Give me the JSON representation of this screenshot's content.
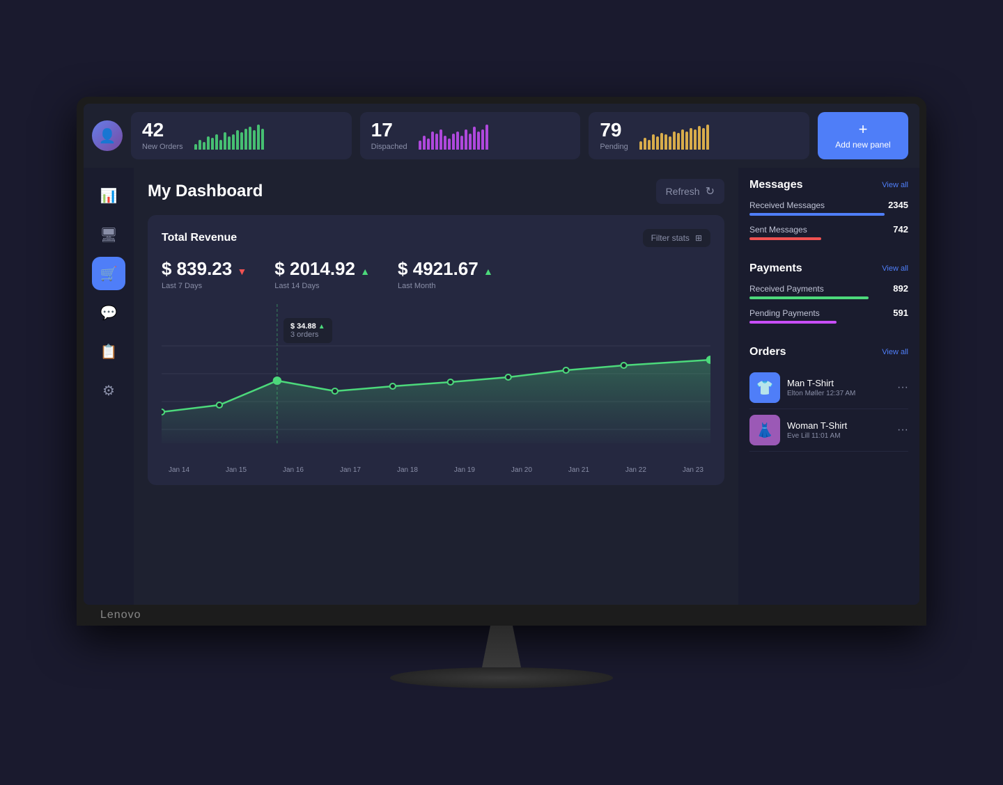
{
  "header": {
    "stats": [
      {
        "number": "42",
        "label": "New Orders",
        "color": "#4cd97b",
        "bars": [
          3,
          5,
          4,
          7,
          6,
          8,
          5,
          9,
          7,
          8,
          10,
          9,
          11,
          12,
          10,
          13,
          11
        ]
      },
      {
        "number": "17",
        "label": "Dispached",
        "color": "#c84ef8",
        "bars": [
          4,
          6,
          5,
          8,
          7,
          9,
          6,
          5,
          7,
          8,
          6,
          9,
          7,
          10,
          8,
          9,
          11
        ]
      },
      {
        "number": "79",
        "label": "Pending",
        "color": "#f8c34e",
        "bars": [
          5,
          7,
          6,
          9,
          8,
          10,
          9,
          8,
          11,
          10,
          12,
          11,
          13,
          12,
          14,
          13,
          15
        ]
      }
    ],
    "add_panel_label": "Add new panel",
    "add_panel_plus": "+"
  },
  "sidebar": {
    "items": [
      {
        "icon": "📊",
        "label": "chart-icon",
        "active": false
      },
      {
        "icon": "🖥",
        "label": "monitor-icon",
        "active": false
      },
      {
        "icon": "🛒",
        "label": "cart-icon",
        "active": true
      },
      {
        "icon": "💬",
        "label": "chat-icon",
        "active": false
      },
      {
        "icon": "📋",
        "label": "clipboard-icon",
        "active": false
      },
      {
        "icon": "⚙",
        "label": "settings-icon",
        "active": false
      }
    ]
  },
  "dashboard": {
    "title": "My Dashboard",
    "refresh_label": "Refresh",
    "revenue": {
      "title": "Total Revenue",
      "filter_label": "Filter stats",
      "stats": [
        {
          "amount": "$ 839.23",
          "direction": "down",
          "period": "Last 7 Days"
        },
        {
          "amount": "$ 2014.92",
          "direction": "up",
          "period": "Last 14 Days"
        },
        {
          "amount": "$ 4921.67",
          "direction": "up",
          "period": "Last Month"
        }
      ],
      "tooltip": {
        "amount": "$ 34.88",
        "arrow": "▲",
        "orders": "3 orders"
      },
      "x_labels": [
        "Jan 14",
        "Jan 15",
        "Jan 16",
        "Jan 17",
        "Jan 18",
        "Jan 19",
        "Jan 20",
        "Jan 21",
        "Jan 22",
        "Jan 23"
      ]
    }
  },
  "right_panel": {
    "messages": {
      "title": "Messages",
      "view_all": "View all",
      "items": [
        {
          "label": "Received Messages",
          "count": "2345",
          "color": "#4f7ef8",
          "pct": 85
        },
        {
          "label": "Sent Messages",
          "count": "742",
          "color": "#f05252",
          "pct": 45
        }
      ]
    },
    "payments": {
      "title": "Payments",
      "view_all": "View all",
      "items": [
        {
          "label": "Received Payments",
          "count": "892",
          "color": "#4cd97b",
          "pct": 75
        },
        {
          "label": "Pending Payments",
          "count": "591",
          "color": "#c84ef8",
          "pct": 55
        }
      ]
    },
    "orders": {
      "title": "Orders",
      "view_all": "View all",
      "items": [
        {
          "name": "Man T-Shirt",
          "meta": "Elton Møller   12:37 AM",
          "thumb_bg": "#4f7ef8",
          "thumb_icon": "👕"
        },
        {
          "name": "Woman T-Shirt",
          "meta": "Eve Lill   11:01 AM",
          "thumb_bg": "#9b59b6",
          "thumb_icon": "👗"
        }
      ]
    }
  },
  "brand": "Lenovo"
}
